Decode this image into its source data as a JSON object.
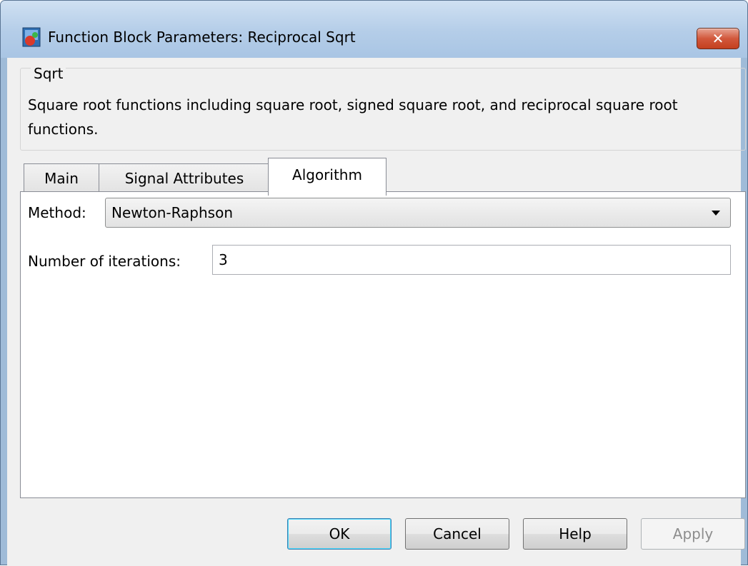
{
  "window": {
    "title": "Function Block Parameters: Reciprocal Sqrt",
    "close_glyph": "✕"
  },
  "description": {
    "group_label": "Sqrt",
    "text": "Square root functions including square root, signed square root, and reciprocal square root functions."
  },
  "tabs": [
    {
      "label": "Main",
      "active": false
    },
    {
      "label": "Signal Attributes",
      "active": false
    },
    {
      "label": "Algorithm",
      "active": true
    }
  ],
  "algorithm": {
    "method_label": "Method:",
    "method_value": "Newton-Raphson",
    "iterations_label": "Number of iterations:",
    "iterations_value": "3"
  },
  "buttons": {
    "ok": "OK",
    "cancel": "Cancel",
    "help": "Help",
    "apply": "Apply"
  },
  "colors": {
    "titlebar": "#b4cde8",
    "close_button": "#c94a2d",
    "panel_bg": "#f0f0f0",
    "default_button_border": "#3c7fb1"
  },
  "icons": {
    "app": "simulink-block-icon",
    "close": "close-icon",
    "dropdown": "chevron-down-icon"
  }
}
